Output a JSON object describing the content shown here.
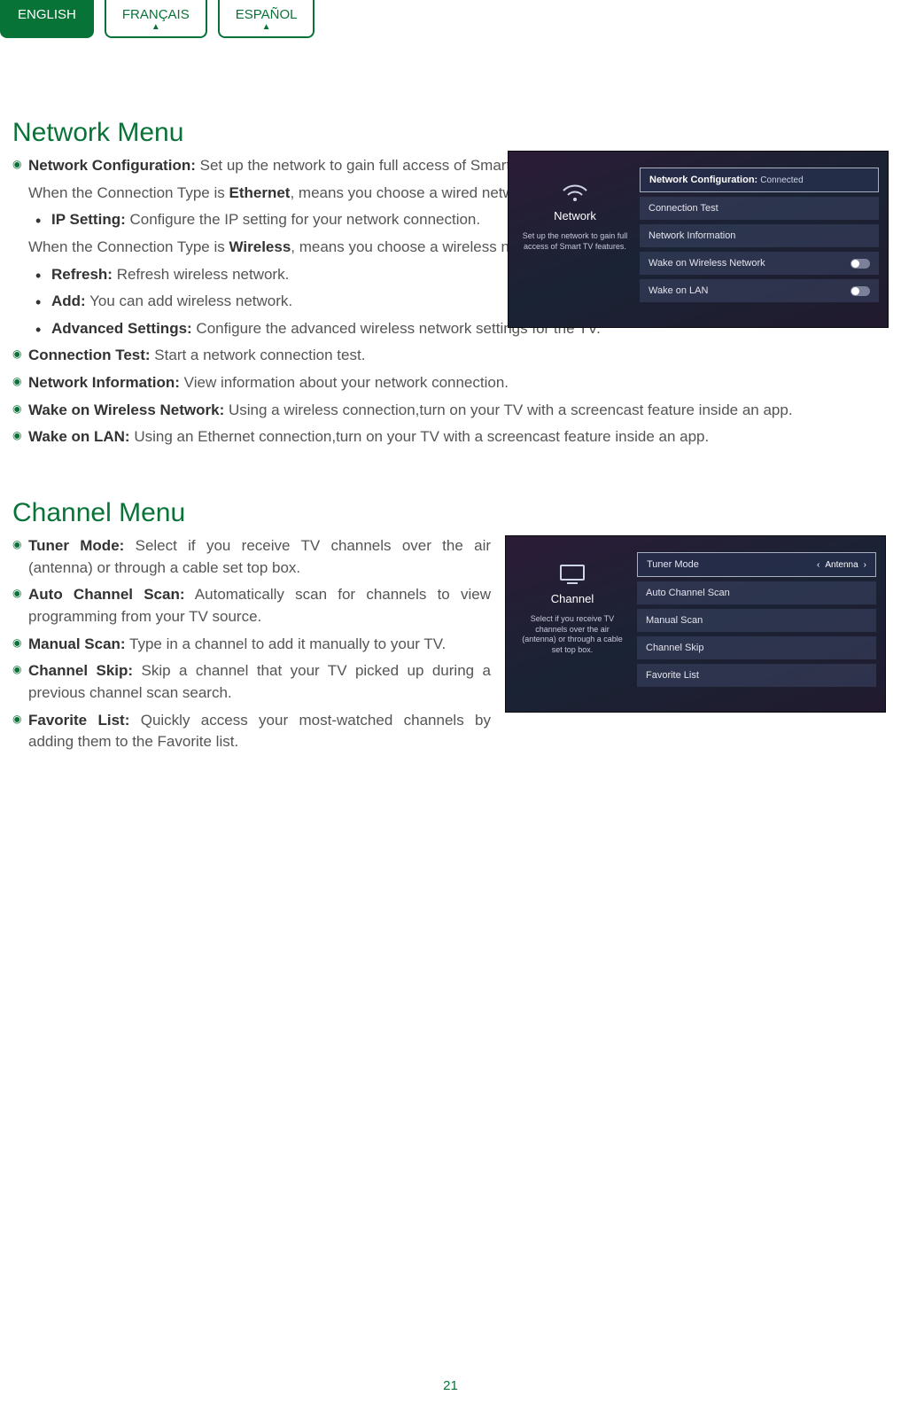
{
  "tabs": {
    "english": "ENGLISH",
    "francais": "FRANÇAIS",
    "espanol": "ESPAÑOL"
  },
  "network": {
    "heading": "Network Menu",
    "items": {
      "config_label": "Network Configuration:",
      "config_desc": " Set up the network to gain full access of Smart TV features.",
      "ethernet_pre": "When the Connection Type is ",
      "ethernet_bold": "Ethernet",
      "ethernet_post": ", means you choose a wired network connection to access the Internet.",
      "ip_label": "IP Setting:",
      "ip_desc": " Configure the IP setting for your network connection.",
      "wireless_pre": "When the Connection Type is ",
      "wireless_bold": "Wireless",
      "wireless_post": ", means you choose a wireless network connection to access the Internet.",
      "refresh_label": "Refresh:",
      "refresh_desc": " Refresh wireless network.",
      "add_label": "Add:",
      "add_desc": " You can add wireless network.",
      "adv_label": "Advanced Settings:",
      "adv_desc": " Configure the advanced wireless network settings for the TV.",
      "conntest_label": "Connection Test:",
      "conntest_desc": " Start a network connection test.",
      "netinfo_label": "Network Information:",
      "netinfo_desc": " View information about your network connection.",
      "wown_label": "Wake on Wireless Network:",
      "wown_desc": " Using a wireless connection,turn on your TV with a screencast feature inside an app.",
      "wol_label": "Wake on LAN:",
      "wol_desc": " Using an Ethernet connection,turn on your TV with a screencast feature inside an app."
    },
    "screenshot": {
      "side_title": "Network",
      "side_desc": "Set up the network to gain full access of Smart TV features.",
      "r1_label": "Network Configuration:",
      "r1_val": "Connected",
      "r2": "Connection Test",
      "r3": "Network Information",
      "r4": "Wake on Wireless Network",
      "r5": "Wake on LAN"
    }
  },
  "channel": {
    "heading": "Channel Menu",
    "items": {
      "tuner_label": "Tuner Mode:",
      "tuner_desc": " Select if you receive TV channels over the air (antenna) or through a cable set top box.",
      "auto_label": "Auto Channel Scan:",
      "auto_desc": " Automatically scan for channels to view programming from your TV source.",
      "manual_label": "Manual Scan:",
      "manual_desc": " Type in a channel to add it manually to your TV.",
      "skip_label": "Channel Skip:",
      "skip_desc": " Skip a channel that your TV picked up during a previous channel scan search.",
      "fav_label": "Favorite List:",
      "fav_desc": " Quickly access your most-watched channels by adding them to the Favorite list."
    },
    "screenshot": {
      "side_title": "Channel",
      "side_desc": "Select if you receive TV channels over the air (antenna) or through a cable set top box.",
      "r1_label": "Tuner Mode",
      "r1_val": "Antenna",
      "r2": "Auto Channel Scan",
      "r3": "Manual Scan",
      "r4": "Channel Skip",
      "r5": "Favorite List"
    }
  },
  "page_number": "21"
}
